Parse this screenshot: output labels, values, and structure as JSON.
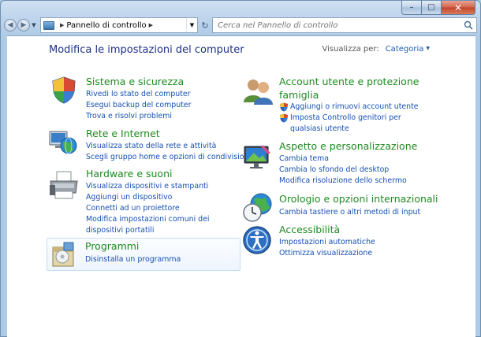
{
  "window": {
    "caption": {
      "min": "–",
      "max": "□",
      "close": "✕"
    }
  },
  "address": {
    "back_icon": "back-arrow-icon",
    "forward_icon": "forward-arrow-icon",
    "location": "Pannello di controllo",
    "search_placeholder": "Cerca nel Pannello di controllo"
  },
  "main": {
    "title": "Modifica le impostazioni del computer",
    "view_by_label": "Visualizza per:",
    "view_by_value": "Categoria"
  },
  "left_categories": [
    {
      "icon": "shield-flag-icon",
      "title": "Sistema e sicurezza",
      "links": [
        "Rivedi lo stato del computer",
        "Esegui backup del computer",
        "Trova e risolvi problemi"
      ]
    },
    {
      "icon": "network-globe-icon",
      "title": "Rete e Internet",
      "links": [
        "Visualizza stato della rete e attività",
        "Scegli gruppo home e opzioni di condivisione"
      ]
    },
    {
      "icon": "printer-icon",
      "title": "Hardware e suoni",
      "links": [
        "Visualizza dispositivi e stampanti",
        "Aggiungi un dispositivo",
        "Connetti ad un proiettore",
        "Modifica impostazioni comuni dei dispositivi portatili"
      ]
    },
    {
      "icon": "programs-icon",
      "title": "Programmi",
      "links": [
        "Disinstalla un programma"
      ]
    }
  ],
  "right_categories": [
    {
      "icon": "users-icon",
      "title": "Account utente e protezione famiglia",
      "links": [
        "Aggiungi o rimuovi account utente",
        "Imposta Controllo genitori per qualsiasi utente"
      ]
    },
    {
      "icon": "appearance-icon",
      "title": "Aspetto e personalizzazione",
      "links": [
        "Cambia tema",
        "Cambia lo sfondo del desktop",
        "Modifica risoluzione dello schermo"
      ]
    },
    {
      "icon": "clock-globe-icon",
      "title": "Orologio e opzioni internazionali",
      "links": [
        "Cambia tastiere o altri metodi di input"
      ]
    },
    {
      "icon": "accessibility-icon",
      "title": "Accessibilità",
      "links": [
        "Impostazioni automatiche",
        "Ottimizza visualizzazione"
      ]
    }
  ]
}
